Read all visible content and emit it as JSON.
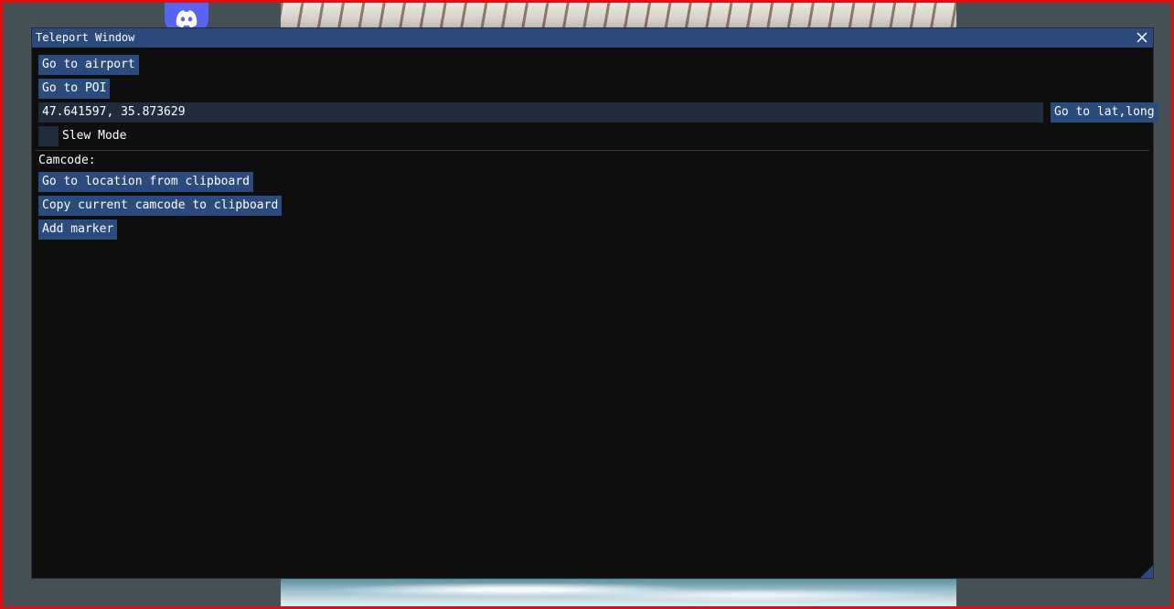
{
  "window": {
    "title": "Teleport Window"
  },
  "buttons": {
    "go_to_airport": "Go to airport",
    "go_to_poi": "Go to POI",
    "go_to_latlong": "Go to lat,long",
    "go_to_location_clipboard": "Go to location from clipboard",
    "copy_camcode": "Copy current camcode to clipboard",
    "add_marker": "Add marker"
  },
  "coordinates_input": {
    "value": "47.641597, 35.873629"
  },
  "slew_mode": {
    "label": "Slew Mode",
    "checked": false
  },
  "camcode": {
    "label": "Camcode:"
  },
  "icons": {
    "close": "close-icon",
    "discord": "discord-icon",
    "resize": "resize-grip-icon"
  },
  "colors": {
    "titlebar": "#294a7a",
    "button": "#2a4b7c",
    "window_bg": "#0e0e0f",
    "input_bg": "#202c3e",
    "frame_border": "#e01010"
  }
}
